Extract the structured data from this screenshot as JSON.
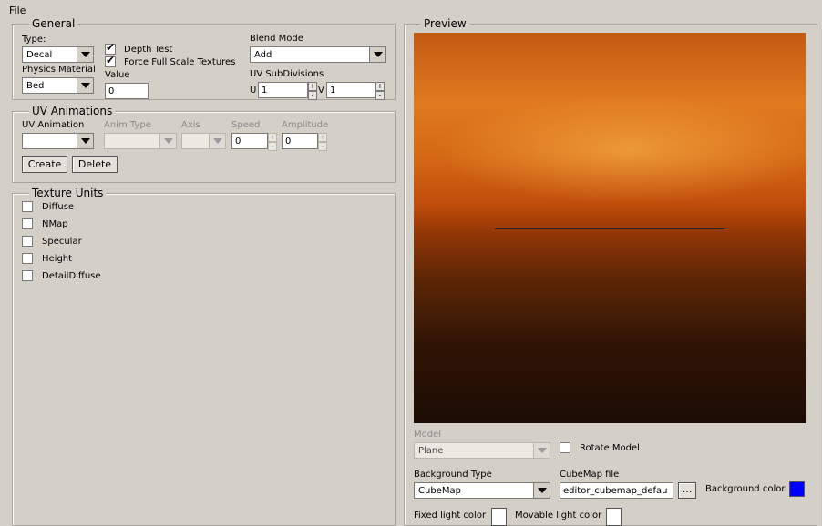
{
  "menu": {
    "file": "File"
  },
  "general": {
    "title": "General",
    "type_label": "Type:",
    "type_value": "Decal",
    "physics_label": "Physics Material",
    "physics_value": "Bed",
    "depth_test_label": "Depth Test",
    "depth_test_checked": true,
    "force_full_label": "Force Full Scale Textures",
    "force_full_checked": true,
    "value_label": "Value",
    "value_value": "0",
    "blend_label": "Blend Mode",
    "blend_value": "Add",
    "uvsub_label": "UV SubDivisions",
    "u_label": "U",
    "u_value": "1",
    "v_label": "V",
    "v_value": "1"
  },
  "uv_animations": {
    "title": "UV Animations",
    "uv_anim_label": "UV Animation",
    "uv_anim_value": "",
    "anim_type_label": "Anim Type",
    "axis_label": "Axis",
    "speed_label": "Speed",
    "speed_value": "0",
    "amplitude_label": "Amplitude",
    "amplitude_value": "0",
    "create_label": "Create",
    "delete_label": "Delete"
  },
  "texture_units": {
    "title": "Texture Units",
    "items": [
      "Diffuse",
      "NMap",
      "Specular",
      "Height",
      "DetailDiffuse"
    ]
  },
  "preview": {
    "title": "Preview",
    "model_label": "Model",
    "model_value": "Plane",
    "rotate_label": "Rotate Model",
    "bg_type_label": "Background Type",
    "bg_type_value": "CubeMap",
    "cubemap_label": "CubeMap file",
    "cubemap_value": "editor_cubemap_defau",
    "browse_label": "...",
    "bg_color_label": "Background color",
    "bg_color": "#0000ff",
    "fixed_light_label": "Fixed light color",
    "fixed_light_color": "#ffffff",
    "movable_light_label": "Movable light color",
    "movable_light_color": "#ffffff"
  },
  "spin_symbols": {
    "up": "+",
    "down": "-"
  }
}
